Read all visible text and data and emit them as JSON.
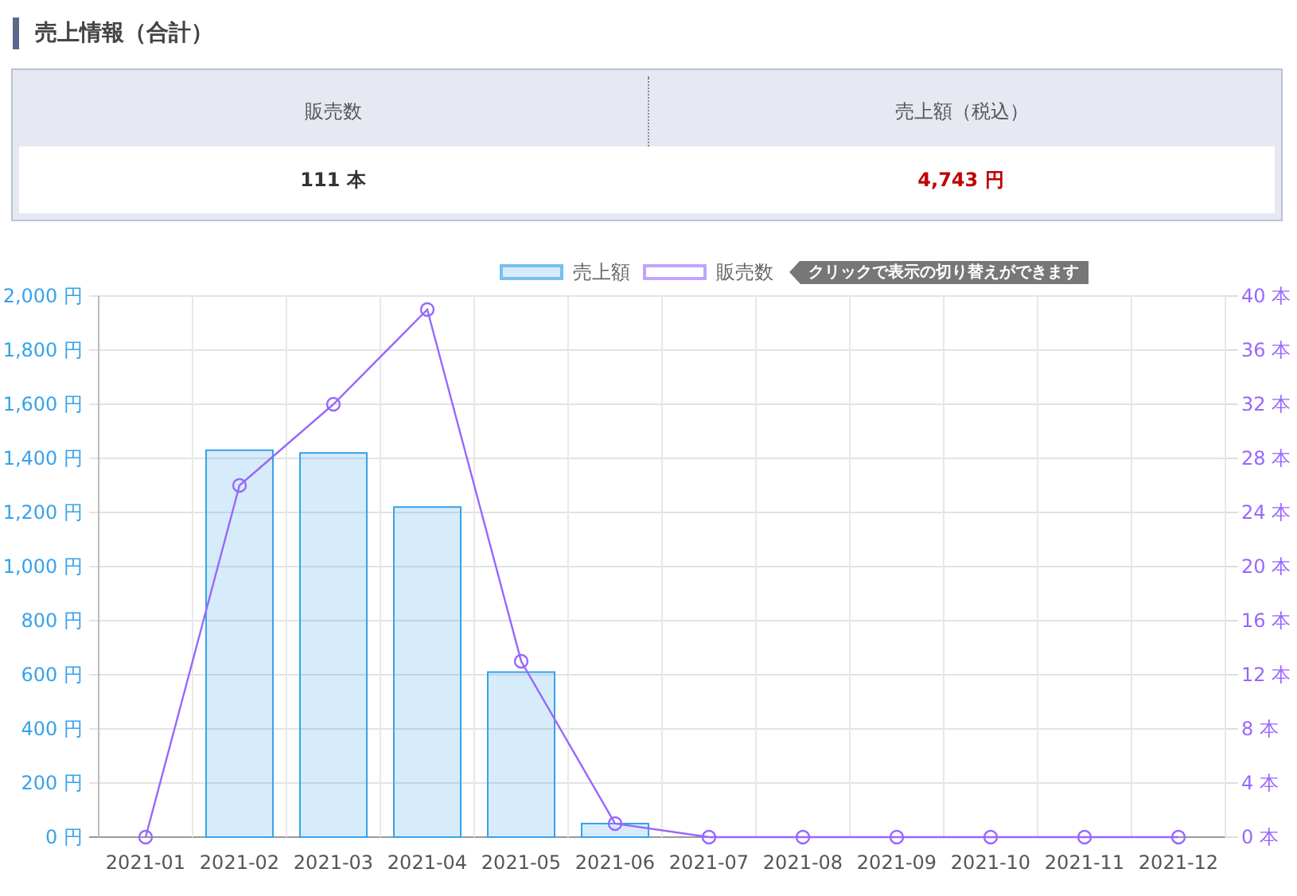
{
  "section_title": "売上情報（合計）",
  "summary": {
    "columns": [
      "販売数",
      "売上額（税込）"
    ],
    "values": [
      {
        "text": "111 本",
        "kind": "count"
      },
      {
        "text": "4,743 円",
        "kind": "amount"
      }
    ]
  },
  "chart": {
    "legend_hint": "クリックで表示の切り替えができます",
    "amount_chart": {
      "chart_data": {
        "type": "bar",
        "categories": [
          "2021-01",
          "2021-02",
          "2021-03",
          "2021-04",
          "2021-05",
          "2021-06",
          "2021-07",
          "2021-08",
          "2021-09",
          "2021-10",
          "2021-11",
          "2021-12"
        ],
        "ylim": [
          0,
          2000
        ],
        "grid": true,
        "yticks": [
          {
            "value": 0,
            "label": "0 円"
          },
          {
            "value": 200,
            "label": "200 円"
          },
          {
            "value": 400,
            "label": "400 円"
          },
          {
            "value": 600,
            "label": "600 円"
          },
          {
            "value": 800,
            "label": "800 円"
          },
          {
            "value": 1000,
            "label": "1,000 円"
          },
          {
            "value": 1200,
            "label": "1,200 円"
          },
          {
            "value": 1400,
            "label": "1,400 円"
          },
          {
            "value": 1600,
            "label": "1,600 円"
          },
          {
            "value": 1800,
            "label": "1,800 円"
          },
          {
            "value": 2000,
            "label": "2,000 円"
          }
        ],
        "series": [
          {
            "name": "売上額",
            "color": "#36a2eb",
            "values": [
              0,
              1430,
              1420,
              1220,
              610,
              50,
              0,
              0,
              0,
              0,
              0,
              0
            ]
          }
        ]
      }
    },
    "count_chart": {
      "chart_data": {
        "type": "line",
        "categories": [
          null,
          null,
          null,
          null,
          null,
          null,
          null,
          null,
          null,
          null,
          null,
          null
        ],
        "ylim": [
          0,
          40
        ],
        "yticks": [
          {
            "value": 0,
            "label": "0 本"
          },
          {
            "value": 4,
            "label": "4 本"
          },
          {
            "value": 8,
            "label": "8 本"
          },
          {
            "value": 12,
            "label": "12 本"
          },
          {
            "value": 16,
            "label": "16 本"
          },
          {
            "value": 20,
            "label": "20 本"
          },
          {
            "value": 24,
            "label": "24 本"
          },
          {
            "value": 28,
            "label": "28 本"
          },
          {
            "value": 32,
            "label": "32 本"
          },
          {
            "value": 36,
            "label": "36 本"
          },
          {
            "value": 40,
            "label": "40 本"
          }
        ],
        "series": [
          {
            "name": "販売数",
            "color": "#9966ff",
            "marker": "circle",
            "values": [
              0,
              26,
              32,
              39,
              13,
              1,
              0,
              0,
              0,
              0,
              0,
              0
            ]
          }
        ]
      }
    }
  }
}
